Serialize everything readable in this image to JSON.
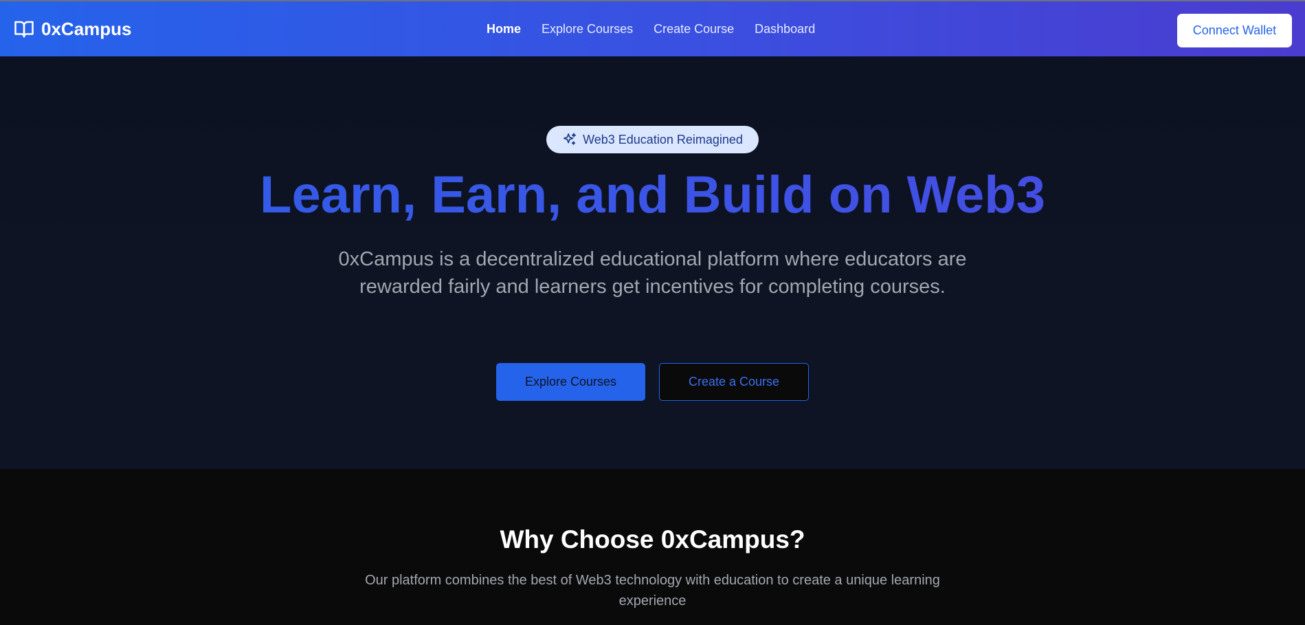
{
  "nav": {
    "brand": "0xCampus",
    "brand_icon": "book-open-icon",
    "links": [
      {
        "label": "Home",
        "active": true
      },
      {
        "label": "Explore Courses",
        "active": false
      },
      {
        "label": "Create Course",
        "active": false
      },
      {
        "label": "Dashboard",
        "active": false
      }
    ],
    "connect_label": "Connect Wallet"
  },
  "hero": {
    "badge_icon": "sparkles-icon",
    "badge_text": "Web3 Education Reimagined",
    "title": "Learn, Earn, and Build on Web3",
    "subtitle": "0xCampus is a decentralized educational platform where educators are rewarded fairly and learners get incentives for completing courses.",
    "primary_cta": "Explore Courses",
    "secondary_cta": "Create a Course"
  },
  "features": {
    "title": "Why Choose 0xCampus?",
    "subtitle": "Our platform combines the best of Web3 technology with education to create a unique learning experience"
  },
  "colors": {
    "accent": "#2563eb",
    "nav_gradient_end": "#4a3ccf",
    "hero_bg": "#0e1424",
    "section_bg": "#0a0a0a",
    "badge_bg": "#dbe7ff"
  }
}
